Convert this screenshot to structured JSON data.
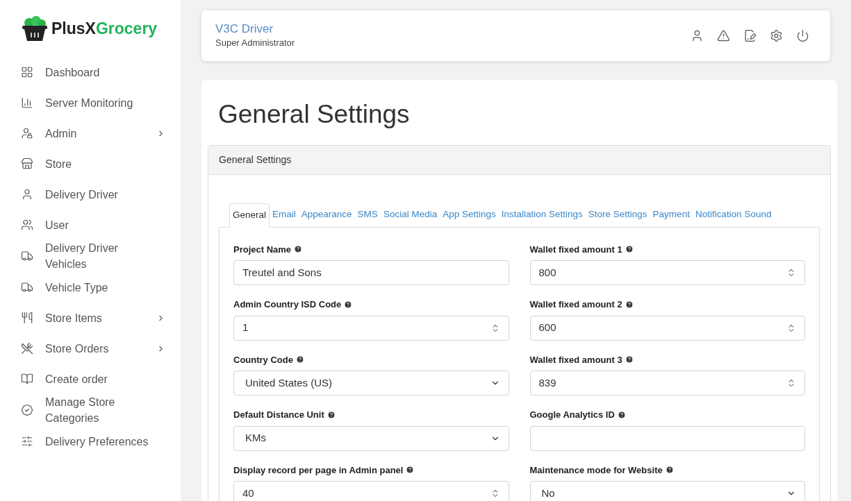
{
  "brand": {
    "part1": "PlusX",
    "part2": "Grocery"
  },
  "sidebar": {
    "items": [
      {
        "label": "Dashboard",
        "expandable": false
      },
      {
        "label": "Server Monitoring",
        "expandable": false
      },
      {
        "label": "Admin",
        "expandable": true
      },
      {
        "label": "Store",
        "expandable": false
      },
      {
        "label": "Delivery Driver",
        "expandable": false
      },
      {
        "label": "User",
        "expandable": false
      },
      {
        "label": "Delivery Driver Vehicles",
        "expandable": false
      },
      {
        "label": "Vehicle Type",
        "expandable": false
      },
      {
        "label": "Store Items",
        "expandable": true
      },
      {
        "label": "Store Orders",
        "expandable": true
      },
      {
        "label": "Create order",
        "expandable": false
      },
      {
        "label": "Manage Store Categories",
        "expandable": false
      },
      {
        "label": "Delivery Preferences",
        "expandable": false
      }
    ]
  },
  "header": {
    "user_name": "V3C Driver",
    "role": "Super Administrator"
  },
  "page_title": "General Settings",
  "panel_title": "General Settings",
  "tabs": [
    {
      "label": "General",
      "selected": true
    },
    {
      "label": "Email",
      "selected": false
    },
    {
      "label": "Appearance",
      "selected": false
    },
    {
      "label": "SMS",
      "selected": false
    },
    {
      "label": "Social Media",
      "selected": false
    },
    {
      "label": "App Settings",
      "selected": false
    },
    {
      "label": "Installation Settings",
      "selected": false
    },
    {
      "label": "Store Settings",
      "selected": false
    },
    {
      "label": "Payment",
      "selected": false
    },
    {
      "label": "Notification Sound",
      "selected": false
    }
  ],
  "fields": [
    {
      "label": "Project Name",
      "kind": "text",
      "value": "Treutel and Sons"
    },
    {
      "label": "Wallet fixed amount 1",
      "kind": "number",
      "value": "800"
    },
    {
      "label": "Admin Country ISD Code",
      "kind": "number",
      "value": "1"
    },
    {
      "label": "Wallet fixed amount 2",
      "kind": "number",
      "value": "600"
    },
    {
      "label": "Country Code",
      "kind": "select",
      "value": "United States (US)"
    },
    {
      "label": "Wallet fixed amount 3",
      "kind": "number",
      "value": "839"
    },
    {
      "label": "Default Distance Unit",
      "kind": "select",
      "value": "KMs"
    },
    {
      "label": "Google Analytics ID",
      "kind": "text"
    },
    {
      "label": "Display record per page in Admin panel",
      "kind": "number",
      "value": "40"
    },
    {
      "label": "Maintenance mode for Website",
      "kind": "select",
      "value": "No"
    }
  ]
}
